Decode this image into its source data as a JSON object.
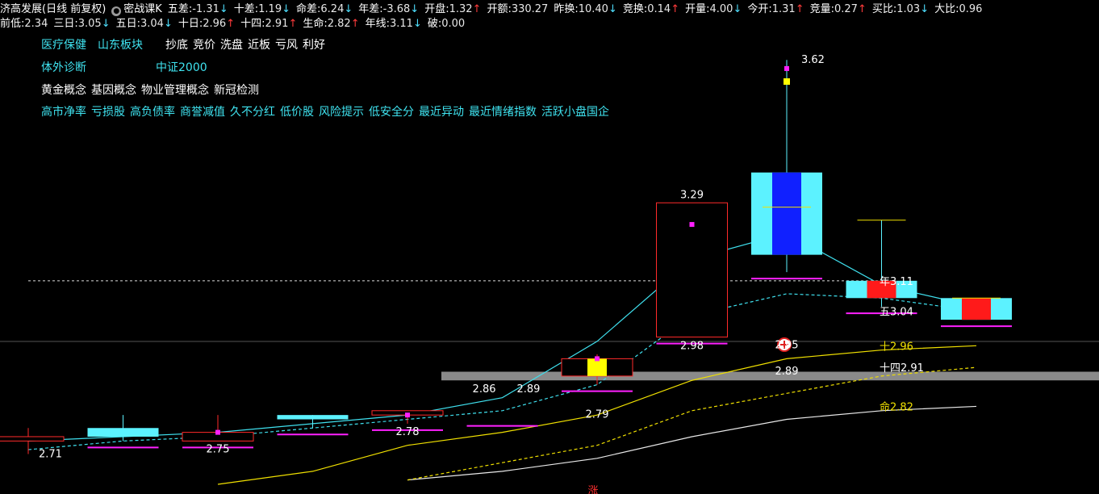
{
  "header": {
    "stock_name": "济高发展",
    "stock_mode": "(日线 前复权)",
    "indicator_label": "密战课K",
    "row1": [
      {
        "label": "五差:",
        "value": "-1.31",
        "dir": "down"
      },
      {
        "label": "十差:",
        "value": "1.19",
        "dir": "down"
      },
      {
        "label": "命差:",
        "value": "6.24",
        "dir": "down"
      },
      {
        "label": "年差:",
        "value": "-3.68",
        "dir": "down"
      },
      {
        "label": "开盘:",
        "value": "1.32",
        "dir": "up"
      },
      {
        "label": "开额:",
        "value": "330.27",
        "dir": ""
      },
      {
        "label": "昨换:",
        "value": "10.40",
        "dir": "down"
      },
      {
        "label": "竞换:",
        "value": "0.14",
        "dir": "up"
      },
      {
        "label": "开量:",
        "value": "4.00",
        "dir": "down"
      },
      {
        "label": "今开:",
        "value": "1.31",
        "dir": "up"
      },
      {
        "label": "竞量:",
        "value": "0.27",
        "dir": "up"
      },
      {
        "label": "买比:",
        "value": "1.03",
        "dir": "down"
      },
      {
        "label": "大比:",
        "value": "0.96",
        "dir": ""
      }
    ],
    "row2": [
      {
        "label": "前低:",
        "value": "2.34",
        "dir": ""
      },
      {
        "label": "三日:",
        "value": "3.05",
        "dir": "down"
      },
      {
        "label": "五日:",
        "value": "3.04",
        "dir": "down"
      },
      {
        "label": "十日:",
        "value": "2.96",
        "dir": "up"
      },
      {
        "label": "十四:",
        "value": "2.91",
        "dir": "up"
      },
      {
        "label": "生命:",
        "value": "2.82",
        "dir": "up"
      },
      {
        "label": "年线:",
        "value": "3.11",
        "dir": "down"
      },
      {
        "label": "破:",
        "value": "0.00",
        "dir": ""
      }
    ]
  },
  "tags": {
    "line1_a": [
      "医疗保健",
      "山东板块"
    ],
    "line1_b": [
      "抄底",
      "竞价",
      "洗盘",
      "近板",
      "亏风",
      "利好"
    ],
    "line2": [
      "体外诊断",
      "中证2000"
    ],
    "line3": [
      "黄金概念",
      "基因概念",
      "物业管理概念",
      "新冠检测"
    ],
    "line4": [
      "高市净率",
      "亏损股",
      "高负债率",
      "商誉减值",
      "久不分红",
      "低价股",
      "风险提示",
      "低安全分",
      "最近异动",
      "最近情绪指数",
      "活跃小盘国企"
    ]
  },
  "colors": {
    "up_border": "#ff2a2a",
    "up_fill": "#ff1a1a",
    "down_fill": "#5cf2ff",
    "cyan_line": "#3fe0ee",
    "yellow_line": "#f0e000",
    "white_line": "#e8e8e8",
    "magenta": "#ff20ff",
    "gray_band": "#8a8a8a",
    "blue_body": "#1020ff"
  },
  "chart_data": {
    "type": "candlestick",
    "ylim": [
      2.64,
      3.68
    ],
    "candles": [
      {
        "o": 2.75,
        "c": 2.74,
        "h": 2.77,
        "l": 2.71,
        "kind": "up_hollow"
      },
      {
        "o": 2.77,
        "c": 2.75,
        "h": 2.8,
        "l": 2.74,
        "kind": "down"
      },
      {
        "o": 2.74,
        "c": 2.76,
        "h": 2.8,
        "l": 2.74,
        "kind": "up_hollow"
      },
      {
        "o": 2.8,
        "c": 2.79,
        "h": 2.8,
        "l": 2.77,
        "kind": "down"
      },
      {
        "o": 2.8,
        "c": 2.81,
        "h": 2.81,
        "l": 2.78,
        "kind": "up_hollow"
      },
      {
        "o": 2.85,
        "c": 2.85,
        "h": 2.86,
        "l": 2.79,
        "kind": "skip"
      },
      {
        "o": 2.89,
        "c": 2.93,
        "h": 2.94,
        "l": 2.87,
        "kind": "up_yellow"
      },
      {
        "o": 2.98,
        "c": 3.29,
        "h": 3.29,
        "l": 2.98,
        "kind": "up_hollow"
      },
      {
        "o": 3.36,
        "c": 3.17,
        "h": 3.62,
        "l": 3.13,
        "kind": "down_blue"
      },
      {
        "o": 3.11,
        "c": 3.07,
        "h": 3.25,
        "l": 3.05,
        "kind": "down_red"
      },
      {
        "o": 3.07,
        "c": 3.02,
        "h": 3.07,
        "l": 3.02,
        "kind": "down_red"
      }
    ],
    "ma_cyan": [
      2.74,
      2.75,
      2.76,
      2.78,
      2.8,
      2.84,
      2.97,
      3.16,
      3.22,
      3.1,
      3.05
    ],
    "ma_cyan_dash": [
      2.72,
      2.74,
      2.75,
      2.77,
      2.79,
      2.81,
      2.87,
      3.03,
      3.08,
      3.07,
      3.04
    ],
    "ma_yellow": [
      null,
      null,
      2.64,
      2.67,
      2.73,
      2.76,
      2.8,
      2.88,
      2.93,
      2.95,
      2.96
    ],
    "ma_yellow_dash": [
      null,
      null,
      null,
      null,
      2.65,
      2.69,
      2.73,
      2.81,
      2.85,
      2.89,
      2.91
    ],
    "ma_white": [
      null,
      null,
      null,
      null,
      2.65,
      2.67,
      2.7,
      2.75,
      2.79,
      2.81,
      2.82
    ],
    "year_line": 3.11,
    "band": [
      2.88,
      2.9
    ],
    "hline": 3.04,
    "labels": [
      {
        "i": 7,
        "y": 3.29,
        "text": "3.29",
        "pos": "above"
      },
      {
        "i": 7,
        "y": 2.98,
        "text": "2.98",
        "pos": "below"
      },
      {
        "i": 8,
        "y": 3.62,
        "text": "3.62",
        "pos": "right"
      },
      {
        "i": 5,
        "y": 2.86,
        "text": "2.86",
        "pos": "left"
      },
      {
        "i": 5,
        "y": 2.86,
        "text": "2.89",
        "pos": "right"
      },
      {
        "i": 0,
        "y": 2.71,
        "text": "2.71",
        "pos": "rightb"
      },
      {
        "i": 2,
        "y": 2.74,
        "text": "2.75",
        "pos": "below2"
      },
      {
        "i": 4,
        "y": 2.78,
        "text": "2.78",
        "pos": "below2"
      },
      {
        "i": 6,
        "y": 2.79,
        "text": "2.79",
        "pos": "center"
      },
      {
        "i": 8,
        "y": 2.89,
        "text": "2.89",
        "pos": "centerw"
      },
      {
        "i": 8,
        "y": 2.95,
        "text": "2.95",
        "pos": "centerw"
      }
    ],
    "end_labels": [
      {
        "prefix": "年",
        "value": "3.11",
        "y": 3.11,
        "color": "white"
      },
      {
        "prefix": "五",
        "value": "3.04",
        "y": 3.04,
        "color": "white"
      },
      {
        "prefix": "十",
        "value": "2.96",
        "y": 2.96,
        "color": "yellow"
      },
      {
        "prefix": "十四",
        "value": "2.91",
        "y": 2.91,
        "color": "white"
      },
      {
        "prefix": "命",
        "value": "2.82",
        "y": 2.82,
        "color": "yellow"
      }
    ],
    "bottom_mark": "涨"
  }
}
